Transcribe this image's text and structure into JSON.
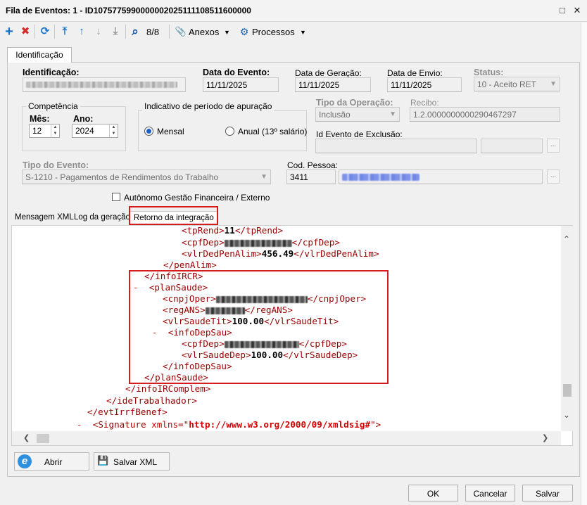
{
  "window": {
    "title": "Fila de Eventos: 1 - ID1075775990000002025111108511600000",
    "maximize_glyph": "□",
    "close_glyph": "✕"
  },
  "toolbar": {
    "add_icon": "+",
    "delete_icon": "✖",
    "refresh_icon": "⟳",
    "first_icon": "⤒",
    "prev_icon": "↑",
    "next_icon": "↓",
    "last_icon": "⤓",
    "search_icon": "⌕",
    "page_counter": "8/8",
    "attachments_icon": "📎",
    "attachments_label": "Anexos",
    "processes_icon": "⚙",
    "processes_label": "Processos",
    "caret": "▼"
  },
  "tabs": {
    "identificacao": "Identificação"
  },
  "form": {
    "identificacao_label": "Identificação:",
    "data_evento_label": "Data do Evento:",
    "data_evento_value": "11/11/2025",
    "data_geracao_label": "Data de Geração:",
    "data_geracao_value": "11/11/2025",
    "data_envio_label": "Data de Envio:",
    "data_envio_value": "11/11/2025",
    "status_label": "Status:",
    "status_value": "10 - Aceito RET",
    "competencia_label": "Competência",
    "mes_label": "Mês:",
    "mes_value": "12",
    "ano_label": "Ano:",
    "ano_value": "2024",
    "indicativo_label": "Indicativo de período de apuração",
    "mensal_label": "Mensal",
    "anual_label": "Anual (13º salário)",
    "tipo_operacao_label": "Tipo da Operação:",
    "tipo_operacao_value": "Inclusão",
    "recibo_label": "Recibo:",
    "recibo_value": "1.2.0000000000290467297",
    "id_exclusao_label": "Id Evento de Exclusão:",
    "tipo_evento_label": "Tipo do Evento:",
    "tipo_evento_value": "S-1210 - Pagamentos de Rendimentos do Trabalho",
    "cod_pessoa_label": "Cod. Pessoa:",
    "cod_pessoa_value": "3411",
    "autonomo_label": "Autônomo Gestão Financeira / Externo",
    "dots": "..."
  },
  "inner_tabs": {
    "mensagem_xml": "Mensagem XML",
    "log_geracao": "Log da geração",
    "retorno_integracao": "Retorno da integração"
  },
  "xml": {
    "tpRend_open": "<tpRend>",
    "tpRend_value": "11",
    "tpRend_close": "</tpRend>",
    "cpfDep1_open": "<cpfDep>",
    "cpfDep1_close": "</cpfDep>",
    "vlrDedPenAlim_open": "<vlrDedPenAlim>",
    "vlrDedPenAlim_value": "456.49",
    "vlrDedPenAlim_close": "</vlrDedPenAlim>",
    "penAlim_close": "</penAlim>",
    "infoIRCR_close": "</infoIRCR>",
    "minus": "-",
    "planSaude_open": "<planSaude>",
    "cnpjOper_open": "<cnpjOper>",
    "cnpjOper_close": "</cnpjOper>",
    "regANS_open": "<regANS>",
    "regANS_close": "</regANS>",
    "vlrSaudeTit_open": "<vlrSaudeTit>",
    "vlrSaudeTit_value": "100.00",
    "vlrSaudeTit_close": "</vlrSaudeTit>",
    "infoDepSau_open": "<infoDepSau>",
    "cpfDep2_open": "<cpfDep>",
    "cpfDep2_close": "</cpfDep>",
    "vlrSaudeDep_open": "<vlrSaudeDep>",
    "vlrSaudeDep_value": "100.00",
    "vlrSaudeDep_close": "</vlrSaudeDep>",
    "infoDepSau_close": "</infoDepSau>",
    "planSaude_close": "</planSaude>",
    "infoIRComplem_close": "</infoIRComplem>",
    "ideTrabalhador_close": "</ideTrabalhador>",
    "evtIrrfBenef_close": "</evtIrrfBenef>",
    "signature_open": "<Signature ",
    "signature_attr": "xmlns",
    "signature_eq": "=\"",
    "signature_value": "http://www.w3.org/2000/09/xmldsig#",
    "signature_end": "\">"
  },
  "scroll": {
    "up": "⌃",
    "down": "⌄",
    "left": "❮",
    "right": "❯"
  },
  "bottom_buttons": {
    "abrir_icon": "e",
    "abrir_label": "Abrir",
    "salvar_xml_icon": "💾",
    "salvar_xml_label": "Salvar XML",
    "ok_label": "OK",
    "cancelar_label": "Cancelar",
    "salvar_label": "Salvar"
  },
  "colors": {
    "highlight_border": "#d81b1b",
    "xml_tag": "#990000",
    "radio_selected": "#1b5fc8",
    "add_icon": "#1a73c9",
    "delete_icon": "#d42a2a"
  }
}
